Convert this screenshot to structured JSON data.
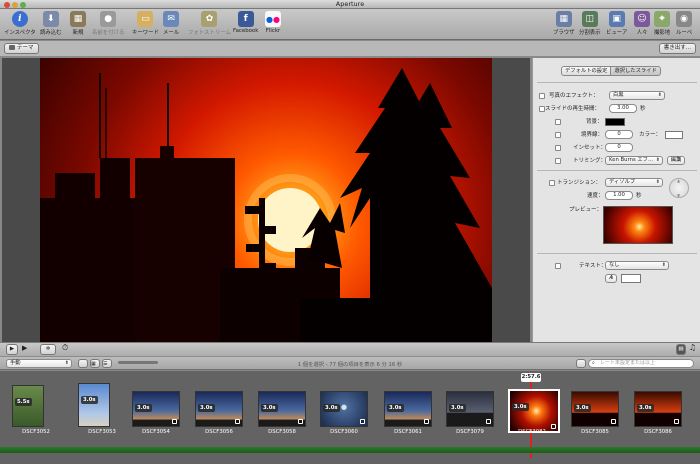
{
  "window": {
    "title": "Aperture"
  },
  "toolbar": {
    "items": [
      {
        "label": "インスペクタ",
        "icon": "info-icon",
        "color": "#3a6fd0",
        "glyph": "i",
        "disabled": false
      },
      {
        "label": "読み込む",
        "icon": "import-icon",
        "color": "#7a8aa8",
        "glyph": "⬇",
        "disabled": false
      },
      {
        "label": "新規",
        "icon": "new-icon",
        "color": "#8a7a5a",
        "glyph": "▦",
        "disabled": false
      },
      {
        "label": "名前を付ける",
        "icon": "name-person-icon",
        "color": "#9a9a9a",
        "glyph": "●",
        "disabled": true
      },
      {
        "label": "キーワード",
        "icon": "keyword-tag-icon",
        "color": "#d6b060",
        "glyph": "▭",
        "disabled": false
      },
      {
        "label": "メール",
        "icon": "mail-icon",
        "color": "#6a88b8",
        "glyph": "✉",
        "disabled": false
      },
      {
        "label": "フォトストリーム",
        "icon": "photostream-icon",
        "color": "#a8a070",
        "glyph": "✿",
        "disabled": true
      },
      {
        "label": "Facebook",
        "icon": "facebook-icon",
        "color": "#3b5998",
        "glyph": "f",
        "disabled": false
      },
      {
        "label": "Flickr",
        "icon": "flickr-icon",
        "color": "#f7f7f7",
        "glyph": "●●",
        "disabled": false
      }
    ],
    "right_items": [
      {
        "label": "ブラウザ",
        "icon": "browser-grid-icon",
        "color": "#6a7ea6",
        "glyph": "▦"
      },
      {
        "label": "分割表示",
        "icon": "split-view-icon",
        "color": "#5a7a5a",
        "glyph": "◫"
      },
      {
        "label": "ビューア",
        "icon": "viewer-icon",
        "color": "#5a7ab0",
        "glyph": "▣"
      },
      {
        "label": "人々",
        "icon": "faces-icon",
        "color": "#7a5a9a",
        "glyph": "☺"
      },
      {
        "label": "撮影地",
        "icon": "places-map-icon",
        "color": "#8aa86a",
        "glyph": "⌖"
      },
      {
        "label": "ルーペ",
        "icon": "loupe-icon",
        "color": "#888888",
        "glyph": "◉"
      }
    ]
  },
  "strip": {
    "theme_button": "テーマ",
    "export_button": "書き出す..."
  },
  "inspector": {
    "tabs": [
      "デフォルトの設定",
      "選択したスライド"
    ],
    "photo_effect_label": "写真のエフェクト：",
    "photo_effect_value": "白黒",
    "slide_duration_label": "スライドの再生時間：",
    "slide_duration_value": "3.00",
    "seconds_unit": "秒",
    "background_label": "背景：",
    "border_label": "境界線：",
    "border_value": "0",
    "color_label": "カラー：",
    "inset_label": "インセット：",
    "inset_value": "0",
    "trimming_label": "トリミング：",
    "trimming_value": "Ken Burns エフ…",
    "edit_button": "編集",
    "transition_label": "トランジション：",
    "transition_value": "ディゾルブ",
    "speed_label": "速度：",
    "speed_value": "1.00",
    "preview_label": "プレビュー：",
    "text_label": "テキスト：",
    "text_value": "なし",
    "font_button": "A"
  },
  "browser_bar": {
    "mode_select": "手動",
    "status": "1 個を選択 - 77 個の項目を表示 6 分 16 秒",
    "search_placeholder": "レート未設定または以上"
  },
  "filmstrip": {
    "playhead_time": "2:57.6",
    "thumbs": [
      {
        "name": "DSCF3052",
        "duration": "5.5s",
        "scene": "dog",
        "selected": false
      },
      {
        "name": "DSCF3053",
        "duration": "3.0s",
        "scene": "sky",
        "selected": false
      },
      {
        "name": "DSCF3054",
        "duration": "3.0s",
        "scene": "dusk",
        "selected": false
      },
      {
        "name": "DSCF3056",
        "duration": "3.0s",
        "scene": "dusk",
        "selected": false
      },
      {
        "name": "DSCF3058",
        "duration": "3.0s",
        "scene": "dusk",
        "selected": false
      },
      {
        "name": "DSCF3060",
        "duration": "3.0s",
        "scene": "moon",
        "selected": false
      },
      {
        "name": "DSCF3061",
        "duration": "3.0s",
        "scene": "dusk",
        "selected": false
      },
      {
        "name": "DSCF3079",
        "duration": "3.0s",
        "scene": "city",
        "selected": false
      },
      {
        "name": "DSCF3082",
        "duration": "3.0s",
        "scene": "sunset",
        "selected": true
      },
      {
        "name": "DSCF3085",
        "duration": "3.0s",
        "scene": "sunset-trees",
        "selected": false
      },
      {
        "name": "DSCF3086",
        "duration": "3.0s",
        "scene": "sunset-trees",
        "selected": false
      }
    ]
  },
  "colors": {
    "accent": "#3a6fd0",
    "timeline_green": "#2a7a2a",
    "playhead_red": "#e02020"
  }
}
